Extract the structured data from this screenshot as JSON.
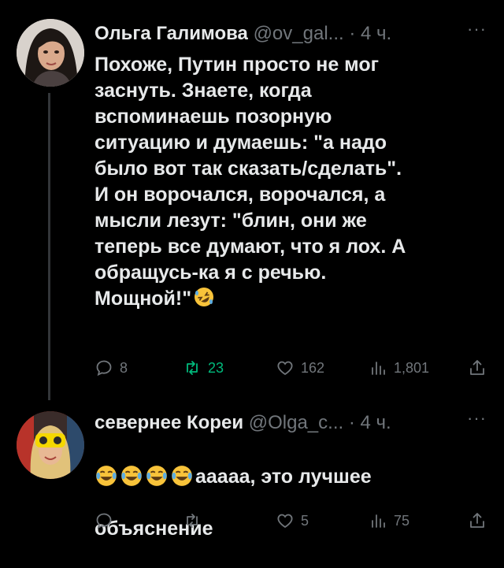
{
  "tweets": [
    {
      "author": {
        "display_name": "Ольга Галимова",
        "handle": "@ov_gal...",
        "time": "4 ч."
      },
      "text": "Похоже, Путин просто не мог\nзаснуть. Знаете, когда\nвспоминаешь позорную\nситуацию и думаешь: \"а надо\nбыло вот так сказать/сделать\".\nИ он ворочался, ворочался, а\nмысли лезут: \"блин, они же\nтеперь все думают, что я лох. А\nобращусь-ка я с речью.\nМощной!\"",
      "emoji_after_text": "rolling-on-floor-laughing-emoji",
      "stats": {
        "replies": "8",
        "retweets": "23",
        "likes": "162",
        "views": "1,801"
      }
    },
    {
      "author": {
        "display_name": "севернее Кореи",
        "handle": "@Olga_c...",
        "time": "4 ч."
      },
      "leading_emoji": [
        "face-with-tears-of-joy-emoji",
        "face-with-tears-of-joy-emoji",
        "face-with-tears-of-joy-emoji",
        "face-with-tears-of-joy-emoji"
      ],
      "text_line1": "ааааа, это лучшее",
      "text_line2": "объяснение",
      "stats": {
        "replies": "",
        "retweets": "",
        "likes": "5",
        "views": "75"
      }
    }
  ],
  "separator": "·",
  "more": "···",
  "colors": {
    "background": "#000000",
    "text": "#e7e9ea",
    "muted": "#71767b",
    "retweet_active": "#00ba7c"
  }
}
